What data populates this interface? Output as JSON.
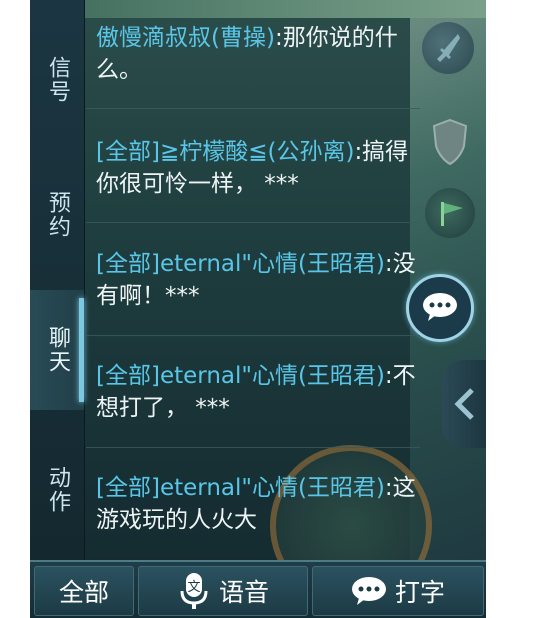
{
  "tabs": [
    {
      "label": "信号",
      "active": false
    },
    {
      "label": "预约",
      "active": false
    },
    {
      "label": "聊天",
      "active": true
    },
    {
      "label": "动作",
      "active": false
    }
  ],
  "messages": [
    {
      "name": "傲慢滴叔叔(曹操)",
      "text": ":那你说的什么。"
    },
    {
      "name": "[全部]≧柠檬酸≦(公孙离)",
      "text": ":搞得你很可怜一样，  ***"
    },
    {
      "name": "[全部]eternal\"心情(王昭君)",
      "text": ":没有啊！***"
    },
    {
      "name": "[全部]eternal\"心情(王昭君)",
      "text": ":不想打了，  ***"
    },
    {
      "name": "[全部]eternal\"心情(王昭君)",
      "text": ":这游戏玩的人火大"
    }
  ],
  "bottom_bar": {
    "all_label": "全部",
    "voice_label": "语音",
    "type_label": "打字",
    "voice_icon_char": "文"
  },
  "colors": {
    "name": "#59c6e8",
    "text": "#eef4f5",
    "accent": "#7cc8e0"
  },
  "icons": [
    "sword-icon",
    "shield-icon",
    "flag-icon",
    "chat-bubble-icon",
    "chevron-left-icon",
    "microphone-icon"
  ]
}
